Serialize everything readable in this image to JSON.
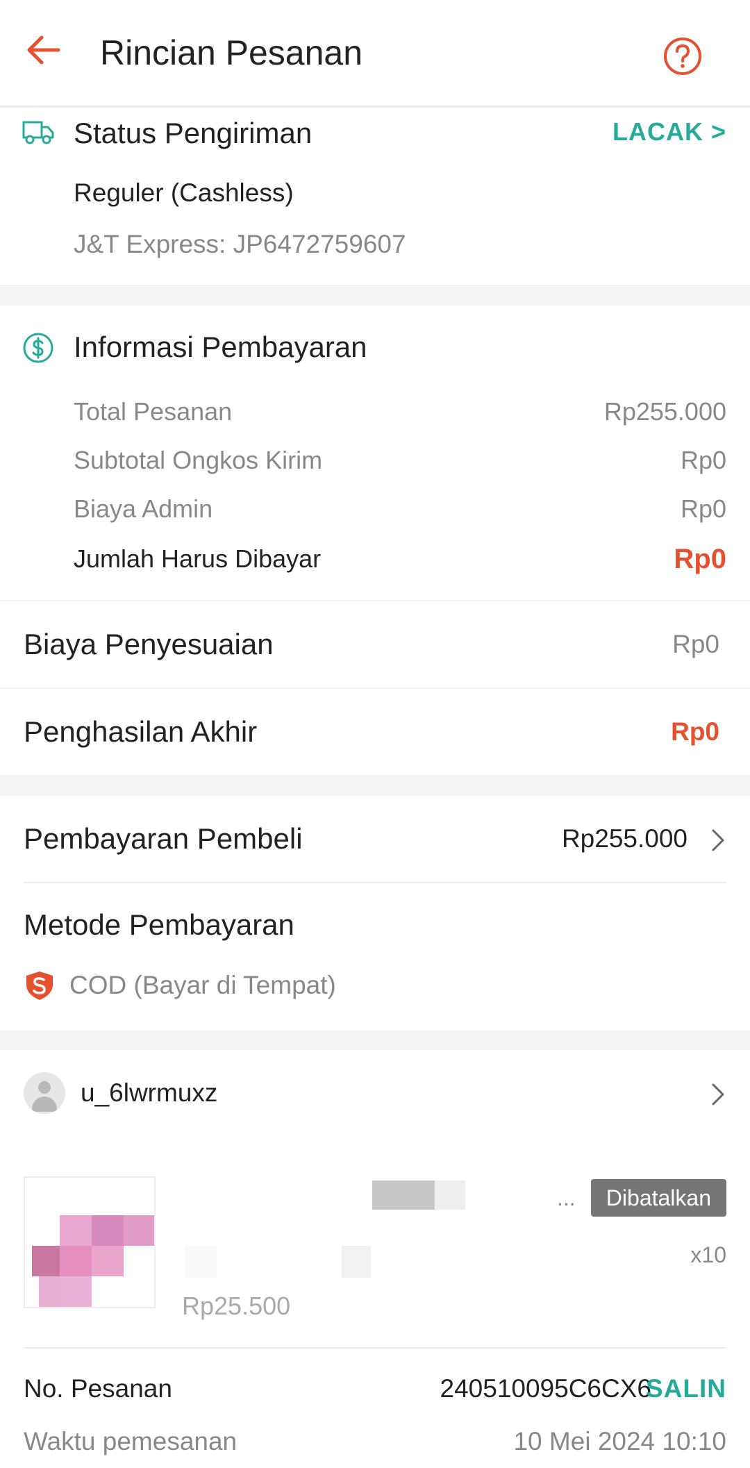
{
  "header": {
    "title": "Rincian Pesanan",
    "back_icon": "arrow-left-icon",
    "help_icon": "question-circle-icon",
    "accent_color": "#e5512f"
  },
  "shipping": {
    "icon": "truck-icon",
    "title": "Status Pengiriman",
    "track_label": "LACAK >",
    "service": "Reguler (Cashless)",
    "tracking": "J&T Express: JP6472759607"
  },
  "payment_info": {
    "icon": "dollar-circle-icon",
    "title": "Informasi Pembayaran",
    "rows": [
      {
        "label": "Total Pesanan",
        "value": "Rp255.000"
      },
      {
        "label": "Subtotal Ongkos Kirim",
        "value": "Rp0"
      },
      {
        "label": "Biaya Admin",
        "value": "Rp0"
      },
      {
        "label": "Jumlah Harus Dibayar",
        "value": "Rp0"
      }
    ]
  },
  "adjustment": {
    "label": "Biaya Penyesuaian",
    "value": "Rp0"
  },
  "final_income": {
    "label": "Penghasilan Akhir",
    "value": "Rp0"
  },
  "buyer_payment": {
    "label": "Pembayaran Pembeli",
    "value": "Rp255.000"
  },
  "payment_method": {
    "title": "Metode Pembayaran",
    "icon": "shield-icon",
    "value": "COD (Bayar di Tempat)"
  },
  "order": {
    "username": "u_6lwrmuxz",
    "status": "Dibatalkan",
    "ellipsis": "...",
    "quantity": "x10",
    "price": "Rp25.500",
    "order_no_label": "No. Pesanan",
    "order_no": "240510095C6CX6",
    "copy_label": "SALIN",
    "time_label": "Waktu pemesanan",
    "time_value": "10 Mei 2024 10:10"
  },
  "colors": {
    "accent_red": "#e5512f",
    "accent_teal": "#26aa99",
    "badge_grey": "#757575"
  }
}
